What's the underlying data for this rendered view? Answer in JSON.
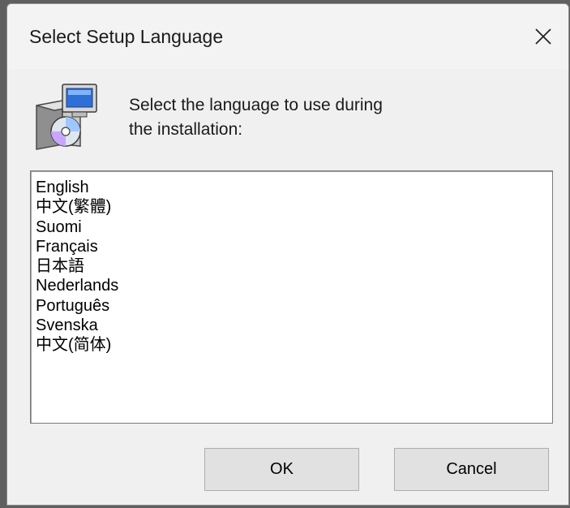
{
  "window": {
    "title": "Select Setup Language"
  },
  "icons": {
    "close": "close-icon",
    "setup": "setup-installer-icon"
  },
  "prompt": {
    "line1": "Select the language to use during",
    "line2": "the installation:"
  },
  "languages": [
    "English",
    "中文(繁體)",
    "Suomi",
    "Français",
    "日本語",
    "Nederlands",
    "Português",
    "Svenska",
    "中文(简体)"
  ],
  "buttons": {
    "ok": "OK",
    "cancel": "Cancel"
  },
  "colors": {
    "dialog_bg": "#f0f0f0",
    "button_bg": "#e1e1e1",
    "list_bg": "#ffffff"
  }
}
